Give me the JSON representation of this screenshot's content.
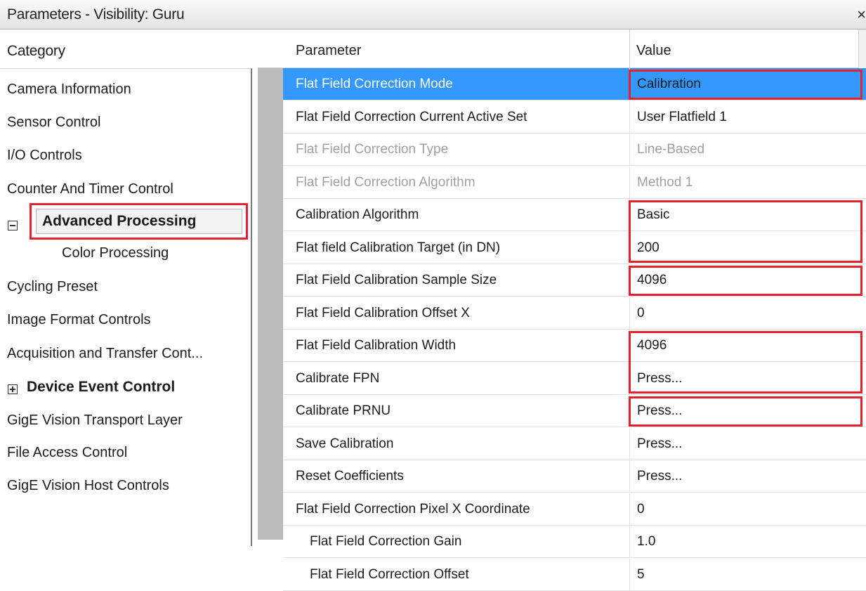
{
  "window": {
    "title": "Parameters - Visibility: Guru",
    "close_glyph": "×"
  },
  "categories": {
    "header": "Category",
    "items": [
      {
        "label": "Camera Information"
      },
      {
        "label": "Sensor Control"
      },
      {
        "label": "I/O Controls"
      },
      {
        "label": "Counter And Timer Control"
      },
      {
        "label": "Advanced Processing",
        "selected": true,
        "expanded": true
      },
      {
        "label": "Color Processing",
        "child": true
      },
      {
        "label": "Cycling Preset"
      },
      {
        "label": "Image Format Controls"
      },
      {
        "label": "Acquisition and Transfer Cont..."
      },
      {
        "label": "Device Event Control",
        "collapsed": true
      },
      {
        "label": "GigE Vision Transport Layer"
      },
      {
        "label": "File Access Control"
      },
      {
        "label": "GigE Vision Host Controls"
      }
    ]
  },
  "grid": {
    "parameter_header": "Parameter",
    "value_header": "Value",
    "rows": [
      {
        "parameter": "Flat Field Correction Mode",
        "value": "Calibration",
        "selected": true,
        "highlighted": true
      },
      {
        "parameter": "Flat Field Correction Current Active Set",
        "value": "User Flatfield 1"
      },
      {
        "parameter": "Flat Field Correction Type",
        "value": "Line-Based",
        "disabled": true
      },
      {
        "parameter": "Flat Field Correction Algorithm",
        "value": "Method 1",
        "disabled": true
      },
      {
        "parameter": "Calibration Algorithm",
        "value": "Basic",
        "highlighted": true
      },
      {
        "parameter": "Flat field Calibration Target (in DN)",
        "value": "200",
        "highlighted": true
      },
      {
        "parameter": "Flat Field Calibration Sample Size",
        "value": "4096",
        "highlighted": true
      },
      {
        "parameter": "Flat Field Calibration Offset X",
        "value": "0"
      },
      {
        "parameter": "Flat Field Calibration Width",
        "value": "4096",
        "highlighted": true
      },
      {
        "parameter": "Calibrate FPN",
        "value": "Press...",
        "highlighted": true
      },
      {
        "parameter": "Calibrate PRNU",
        "value": "Press...",
        "highlighted": true
      },
      {
        "parameter": "Save Calibration",
        "value": "Press..."
      },
      {
        "parameter": "Reset Coefficients",
        "value": "Press..."
      },
      {
        "parameter": "Flat Field Correction Pixel X Coordinate",
        "value": "0"
      },
      {
        "parameter": "Flat Field Correction Gain",
        "value": "1.0",
        "indent": true
      },
      {
        "parameter": "Flat Field Correction Offset",
        "value": "5",
        "indent": true
      }
    ]
  },
  "colors": {
    "selection": "#3399ff",
    "highlight_box": "#e0232f",
    "disabled_text": "#a0a0a0"
  }
}
